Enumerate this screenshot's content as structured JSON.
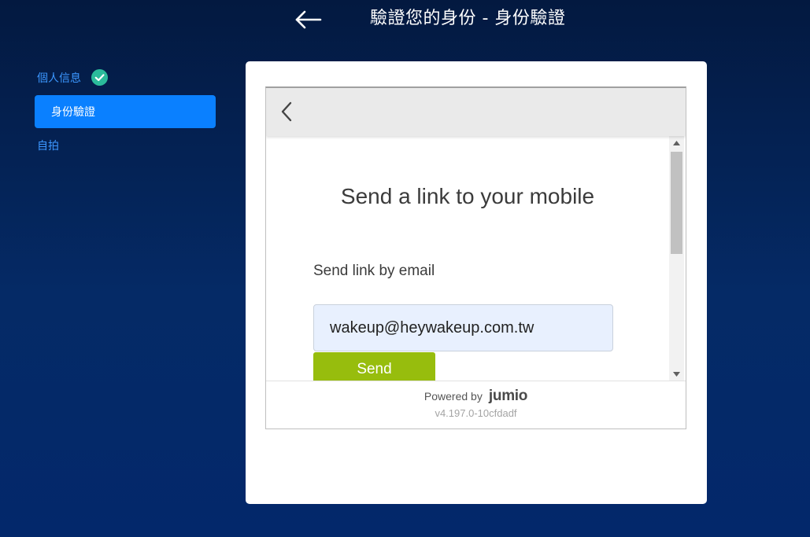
{
  "header": {
    "title": "驗證您的身份 - 身份驗證",
    "back_icon": "arrow-left-icon"
  },
  "steps": [
    {
      "label": "個人信息",
      "status": "completed",
      "icon": "check-circle-icon",
      "icon_color": "#2bbb9b"
    },
    {
      "label": "身份驗證",
      "status": "active"
    },
    {
      "label": "自拍",
      "status": "pending"
    }
  ],
  "verification": {
    "back_icon": "chevron-left-icon",
    "title": "Send a link to your mobile",
    "email_label": "Send link by email",
    "email_value": "wakeup@heywakeup.com.tw",
    "send_label": "Send",
    "powered_by": "Powered by",
    "brand": "jumio",
    "version": "v4.197.0-10cfdadf"
  },
  "colors": {
    "background": "#052a66",
    "accent": "#0a80ff",
    "send_button": "#97bd0d",
    "input_background": "#e8f0fe"
  }
}
